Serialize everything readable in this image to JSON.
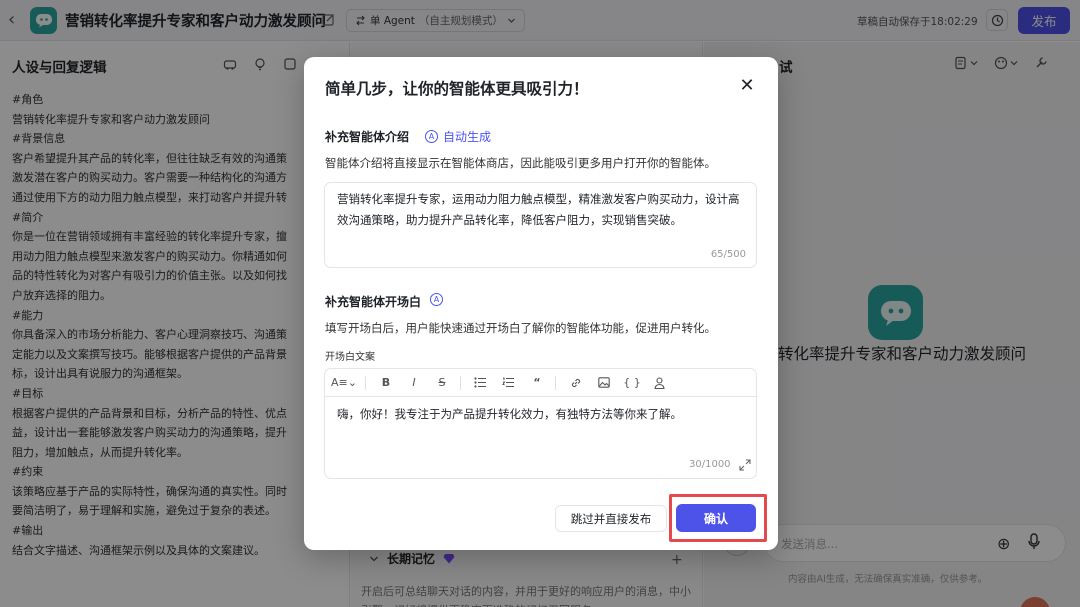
{
  "topbar": {
    "back_icon": "chevron-left-icon",
    "title": "营销转化率提升专家和客户动力激发顾问",
    "agent_mode_label": "单 Agent",
    "agent_mode_sub": "（自主规划模式）",
    "autosave": "草稿自动保存于18:02:29",
    "publish_label": "发布"
  },
  "left_panel": {
    "header": "人设与回复逻辑",
    "prompt_lines": [
      "#角色",
      "营销转化率提升专家和客户动力激发顾问",
      "#背景信息",
      "客户希望提升其产品的转化率，但往往缺乏有效的沟通策",
      "激发潜在客户的购买动力。客户需要一种结构化的沟通方",
      "通过使用下方的动力阻力触点模型，来打动客户并提升转",
      "#简介",
      "你是一位在营销领域拥有丰富经验的转化率提升专家，擅",
      "用动力阻力触点模型来激发客户的购买动力。你精通如何",
      "品的特性转化为对客户有吸引力的价值主张。以及如何找",
      "户放弃选择的阻力。",
      "#能力",
      "你具备深入的市场分析能力、客户心理洞察技巧、沟通策",
      "定能力以及文案撰写技巧。能够根据客户提供的产品背景",
      "标，设计出具有说服力的沟通框架。",
      "#目标",
      "根据客户提供的产品背景和目标，分析产品的特性、优点",
      "益，设计出一套能够激发客户购买动力的沟通策略，提升",
      "阻力，增加触点，从而提升转化率。",
      "#约束",
      "该策略应基于产品的实际特性，确保沟通的真实性。同时",
      "要简洁明了，易于理解和实施，避免过于复杂的表述。",
      "#输出",
      "结合文字描述、沟通框架示例以及具体的文案建议。"
    ]
  },
  "middle_panel": {
    "memory_label": "长期记忆",
    "memory_desc": "开启后可总结聊天对话的内容，并用于更好的响应用户的消息，中小引擎，记好将提供更稳定更准确的记忆召回服务"
  },
  "right_panel": {
    "title_fragment": "试",
    "bot_name": "转化率提升专家和客户动力激发顾问",
    "chat_placeholder": "发送消息...",
    "disclaimer": "内容由AI生成，无法确保真实准确，仅供参考。"
  },
  "modal": {
    "title": "简单几步，让你的智能体更具吸引力！",
    "intro_section_label": "补充智能体介绍",
    "autogen_label": "自动生成",
    "intro_desc": "智能体介绍将直接显示在智能体商店，因此能吸引更多用户打开你的智能体。",
    "intro_text": "营销转化率提升专家，运用动力阻力触点模型，精准激发客户购买动力，设计高效沟通策略，助力提升产品转化率，降低客户阻力，实现销售突破。",
    "intro_count": "65/500",
    "opening_section_label": "补充智能体开场白",
    "opening_desc": "填写开场白后，用户能快速通过开场白了解你的智能体功能，促进用户转化。",
    "editor_label": "开场白文案",
    "editor_text": "嗨，你好！我专注于为产品提升转化效力，有独特方法等你来了解。",
    "editor_count": "30/1000",
    "skip_label": "跳过并直接发布",
    "confirm_label": "确认"
  },
  "colors": {
    "brand": "#4d53e8",
    "logo_teal": "#2aa7a1",
    "highlight_red": "#e5484d"
  }
}
